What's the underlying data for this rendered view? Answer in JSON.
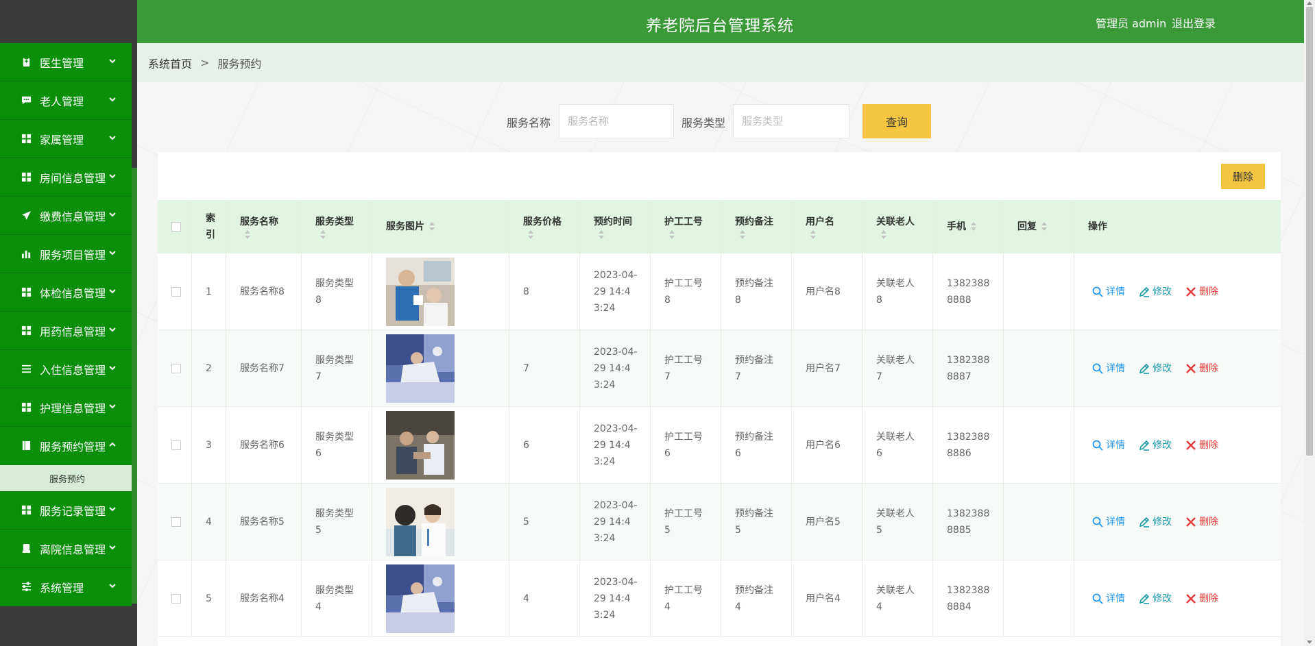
{
  "header": {
    "title": "养老院后台管理系统",
    "user": "管理员 admin",
    "logout": "退出登录"
  },
  "sidebar": {
    "items": [
      {
        "label": "医生管理",
        "icon": "clipboard-icon",
        "expanded": false
      },
      {
        "label": "老人管理",
        "icon": "chat-icon",
        "expanded": false
      },
      {
        "label": "家属管理",
        "icon": "grid-icon",
        "expanded": false
      },
      {
        "label": "房间信息管理",
        "icon": "grid-icon",
        "expanded": false
      },
      {
        "label": "缴费信息管理",
        "icon": "send-icon",
        "expanded": false
      },
      {
        "label": "服务项目管理",
        "icon": "bar-chart-icon",
        "expanded": false
      },
      {
        "label": "体检信息管理",
        "icon": "grid-icon",
        "expanded": false
      },
      {
        "label": "用药信息管理",
        "icon": "grid-icon",
        "expanded": false
      },
      {
        "label": "入住信息管理",
        "icon": "list-icon",
        "expanded": false
      },
      {
        "label": "护理信息管理",
        "icon": "grid-icon",
        "expanded": false
      },
      {
        "label": "服务预约管理",
        "icon": "book-icon",
        "expanded": true
      },
      {
        "label": "服务记录管理",
        "icon": "grid-icon",
        "expanded": false
      },
      {
        "label": "离院信息管理",
        "icon": "printer-icon",
        "expanded": false
      },
      {
        "label": "系统管理",
        "icon": "sliders-icon",
        "expanded": false
      }
    ],
    "subitem": "服务预约"
  },
  "breadcrumb": {
    "home": "系统首页",
    "separator": ">",
    "current": "服务预约"
  },
  "search": {
    "name_label": "服务名称",
    "name_placeholder": "服务名称",
    "type_label": "服务类型",
    "type_placeholder": "服务类型",
    "query_button": "查询"
  },
  "toolbar": {
    "delete_button": "删除"
  },
  "table": {
    "headers": {
      "index": "索引",
      "name": "服务名称",
      "type": "服务类型",
      "image": "服务图片",
      "price": "服务价格",
      "time": "预约时间",
      "nurse": "护工工号",
      "note": "预约备注",
      "user": "用户名",
      "elder": "关联老人",
      "phone": "手机",
      "reply": "回复",
      "ops": "操作"
    },
    "actions": {
      "detail": "详情",
      "edit": "修改",
      "delete": "删除"
    },
    "rows": [
      {
        "index": "1",
        "name": "服务名称8",
        "type": "服务类型8",
        "price": "8",
        "time": "2023-04-29 14:43:24",
        "nurse": "护工工号8",
        "note": "预约备注8",
        "user": "用户名8",
        "elder": "关联老人8",
        "phone": "13823888888",
        "reply": "",
        "photo": "photo-1"
      },
      {
        "index": "2",
        "name": "服务名称7",
        "type": "服务类型7",
        "price": "7",
        "time": "2023-04-29 14:43:24",
        "nurse": "护工工号7",
        "note": "预约备注7",
        "user": "用户名7",
        "elder": "关联老人7",
        "phone": "13823888887",
        "reply": "",
        "photo": "photo-2"
      },
      {
        "index": "3",
        "name": "服务名称6",
        "type": "服务类型6",
        "price": "6",
        "time": "2023-04-29 14:43:24",
        "nurse": "护工工号6",
        "note": "预约备注6",
        "user": "用户名6",
        "elder": "关联老人6",
        "phone": "13823888886",
        "reply": "",
        "photo": "photo-3"
      },
      {
        "index": "4",
        "name": "服务名称5",
        "type": "服务类型5",
        "price": "5",
        "time": "2023-04-29 14:43:24",
        "nurse": "护工工号5",
        "note": "预约备注5",
        "user": "用户名5",
        "elder": "关联老人5",
        "phone": "13823888885",
        "reply": "",
        "photo": "photo-4"
      },
      {
        "index": "5",
        "name": "服务名称4",
        "type": "服务类型4",
        "price": "4",
        "time": "2023-04-29 14:43:24",
        "nurse": "护工工号4",
        "note": "预约备注4",
        "user": "用户名4",
        "elder": "关联老人4",
        "phone": "13823888884",
        "reply": "",
        "photo": "photo-2"
      }
    ]
  },
  "colors": {
    "header_green": "#3a9a3a",
    "sidebar_green": "#0a8f0a",
    "button_yellow": "#f5c542",
    "table_head": "#e2f5e2"
  }
}
